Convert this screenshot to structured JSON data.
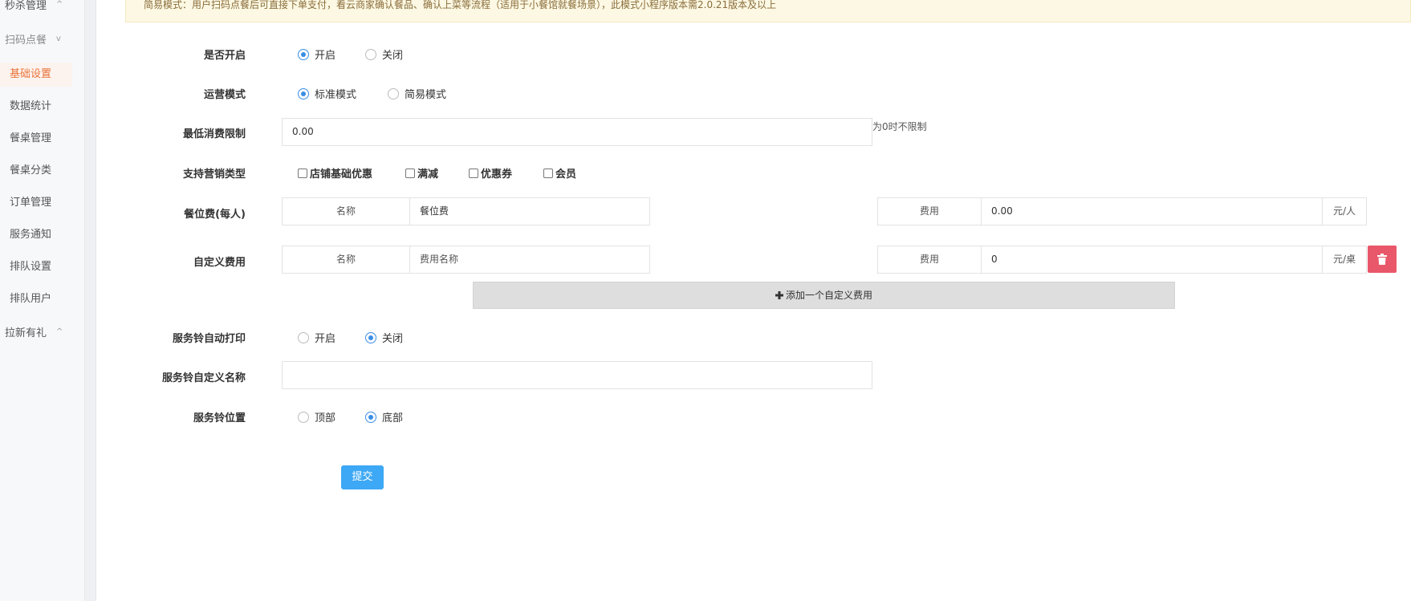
{
  "sidebar": {
    "groups": [
      {
        "label": "秒杀管理",
        "chevron": "^"
      },
      {
        "label": "扫码点餐",
        "chevron": "v"
      },
      {
        "label": "拉新有礼",
        "chevron": "^"
      }
    ],
    "items": [
      {
        "label": "基础设置",
        "active": true
      },
      {
        "label": "数据统计"
      },
      {
        "label": "餐桌管理"
      },
      {
        "label": "餐桌分类"
      },
      {
        "label": "订单管理"
      },
      {
        "label": "服务通知"
      },
      {
        "label": "排队设置"
      },
      {
        "label": "排队用户"
      }
    ]
  },
  "notice": "简易模式：用户扫码点餐后可直接下单支付，看云商家确认餐品、确认上菜等流程（适用于小餐馆就餐场景），此模式小程序版本需2.0.21版本及以上",
  "form": {
    "enable": {
      "label": "是否开启",
      "options": [
        "开启",
        "关闭"
      ],
      "selected": "开启"
    },
    "mode": {
      "label": "运营模式",
      "options": [
        "标准模式",
        "简易模式"
      ],
      "selected": "标准模式"
    },
    "min_consume": {
      "label": "最低消费限制",
      "value": "0.00",
      "hint": "为0时不限制"
    },
    "marketing": {
      "label": "支持营销类型",
      "options": [
        "店铺基础优惠",
        "满减",
        "优惠券",
        "会员"
      ]
    },
    "seat_fee": {
      "label": "餐位费(每人)",
      "name_addon": "名称",
      "name_value": "餐位费",
      "fee_addon": "费用",
      "fee_value": "0.00",
      "unit": "元/人"
    },
    "custom_fee": {
      "label": "自定义费用",
      "name_addon": "名称",
      "name_placeholder": "费用名称",
      "fee_addon": "费用",
      "fee_value": "0",
      "unit": "元/桌"
    },
    "add_custom_fee": "添加一个自定义费用",
    "bell_print": {
      "label": "服务铃自动打印",
      "options": [
        "开启",
        "关闭"
      ],
      "selected": "关闭"
    },
    "bell_name": {
      "label": "服务铃自定义名称",
      "value": ""
    },
    "bell_position": {
      "label": "服务铃位置",
      "options": [
        "顶部",
        "底部"
      ],
      "selected": "底部"
    },
    "submit": "提交"
  },
  "colors": {
    "accent": "#3a8ee6",
    "danger": "#e9586a",
    "active_nav": "#e8733a",
    "submit": "#3da8f5"
  },
  "icons": {
    "delete": "trash-icon",
    "add": "plus-icon"
  }
}
